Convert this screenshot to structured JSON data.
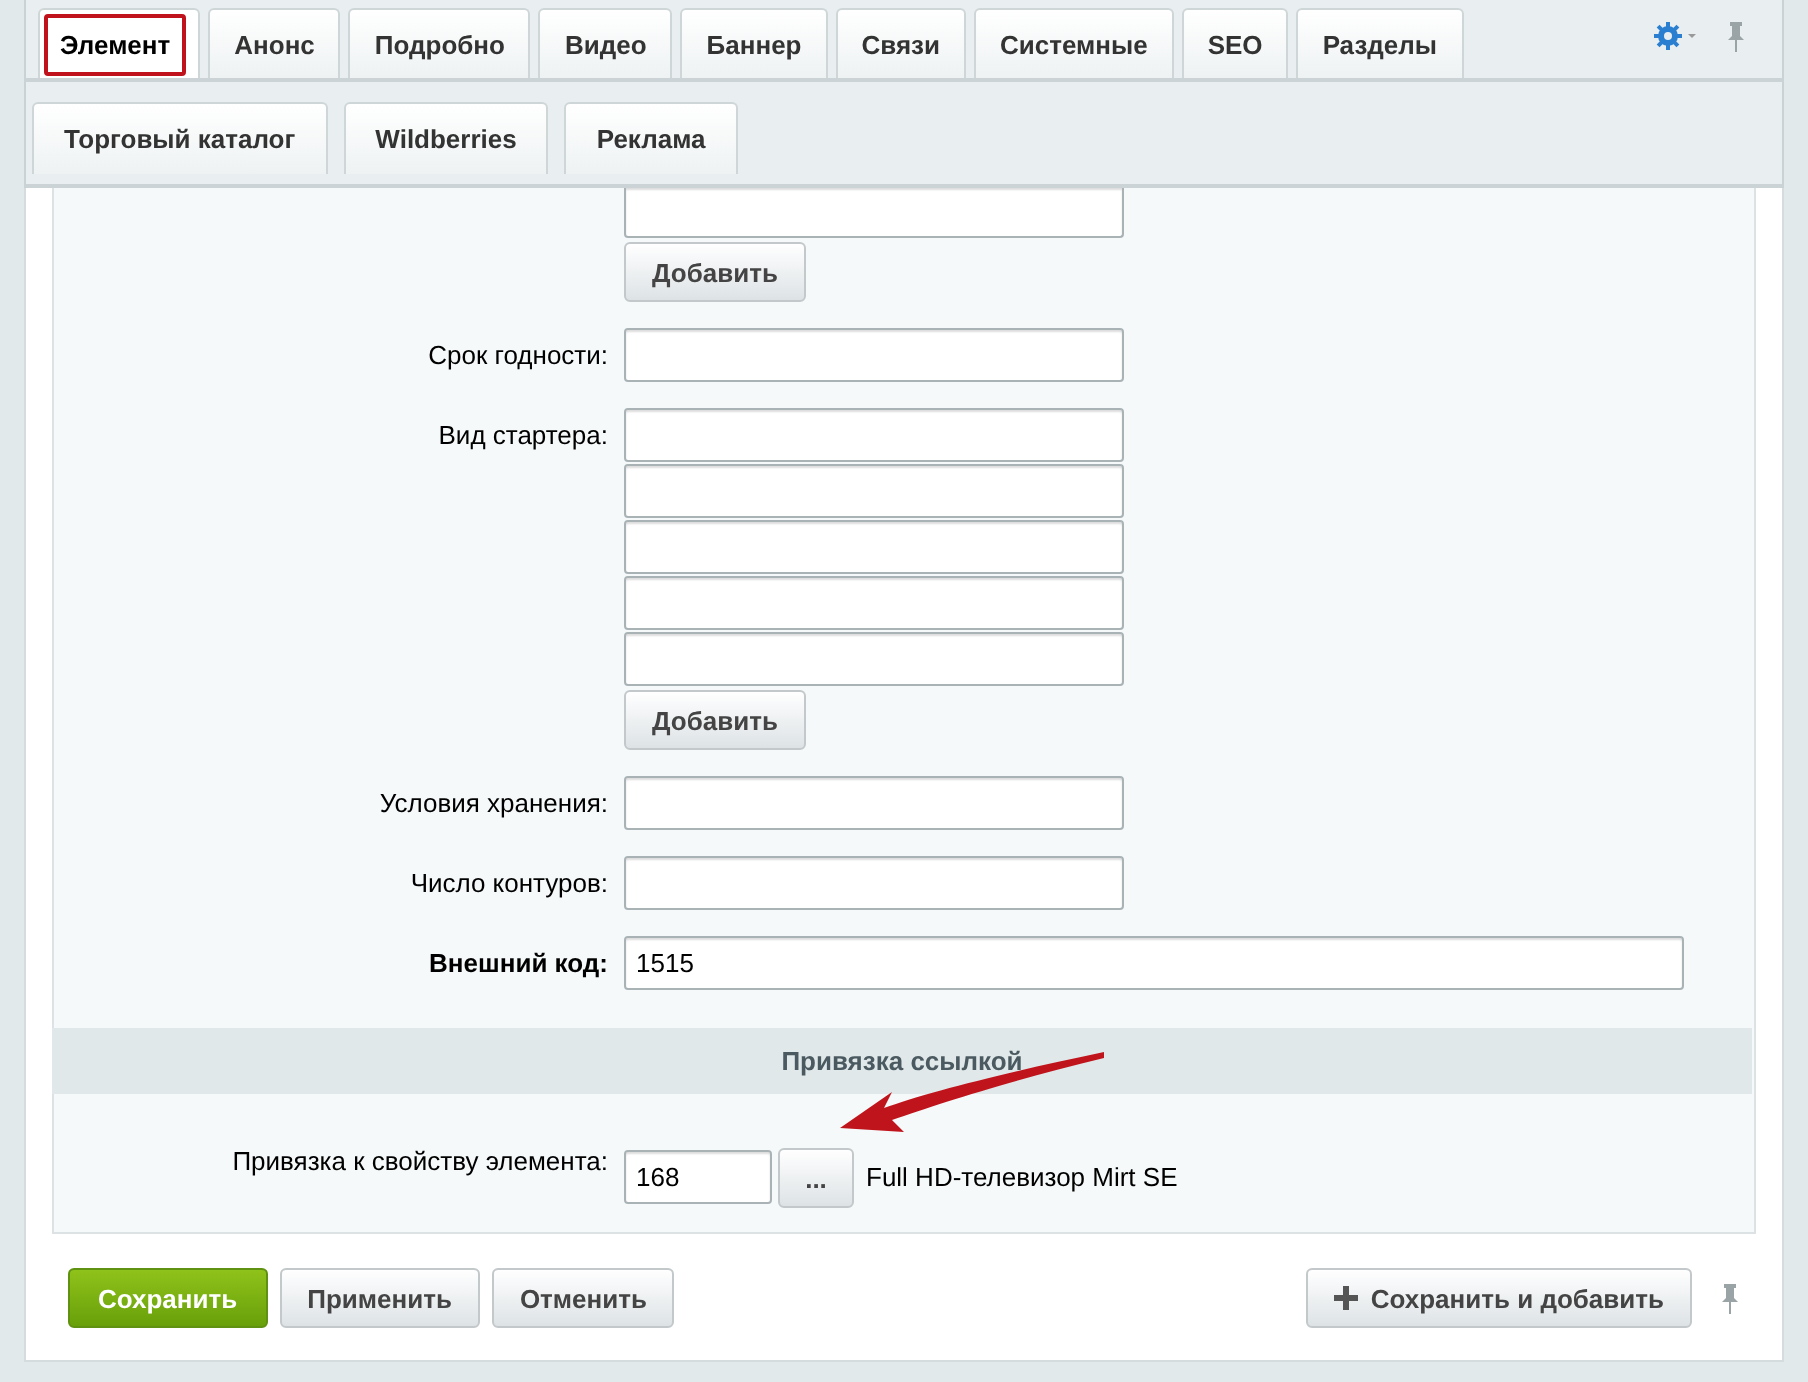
{
  "tabs": [
    {
      "label": "Элемент",
      "selected": true
    },
    {
      "label": "Анонс",
      "selected": false
    },
    {
      "label": "Подробно",
      "selected": false
    },
    {
      "label": "Видео",
      "selected": false
    },
    {
      "label": "Баннер",
      "selected": false
    },
    {
      "label": "Связи",
      "selected": false
    },
    {
      "label": "Системные",
      "selected": false
    },
    {
      "label": "SEO",
      "selected": false
    },
    {
      "label": "Разделы",
      "selected": false
    }
  ],
  "subtabs": [
    {
      "label": "Торговый каталог",
      "selected": false
    },
    {
      "label": "Wildberries",
      "selected": false
    },
    {
      "label": "Реклама",
      "selected": false
    }
  ],
  "form_rows": [
    {
      "kind": "multi",
      "fields": [
        {
          "kind": "text"
        }
      ],
      "add_button": "Добавить"
    },
    {
      "kind": "single",
      "label": "Срок годности:"
    },
    {
      "kind": "multi",
      "label": "Вид стартера:",
      "fields": [
        {
          "kind": "text"
        },
        {
          "kind": "text"
        },
        {
          "kind": "text"
        },
        {
          "kind": "text"
        },
        {
          "kind": "text"
        }
      ],
      "add_button": "Добавить"
    },
    {
      "kind": "single",
      "label": "Условия хранения:"
    },
    {
      "kind": "single",
      "label": "Число контуров:"
    },
    {
      "kind": "wide",
      "label": "Внешний код:",
      "value": "1515"
    },
    {
      "kind": "section",
      "title": "Привязка ссылкой"
    },
    {
      "kind": "link",
      "label": "Привязка к свойству элемента:",
      "value": "168",
      "button": "...",
      "caption": "Full HD-телевизор Mirt SE"
    }
  ],
  "buttons": [
    {
      "label": "Сохранить",
      "kind": "primary"
    },
    {
      "label": "Применить",
      "kind": "normal"
    },
    {
      "label": "Отменить",
      "kind": "normal"
    }
  ],
  "save_add_button": {
    "label": "Сохранить и добавить"
  }
}
